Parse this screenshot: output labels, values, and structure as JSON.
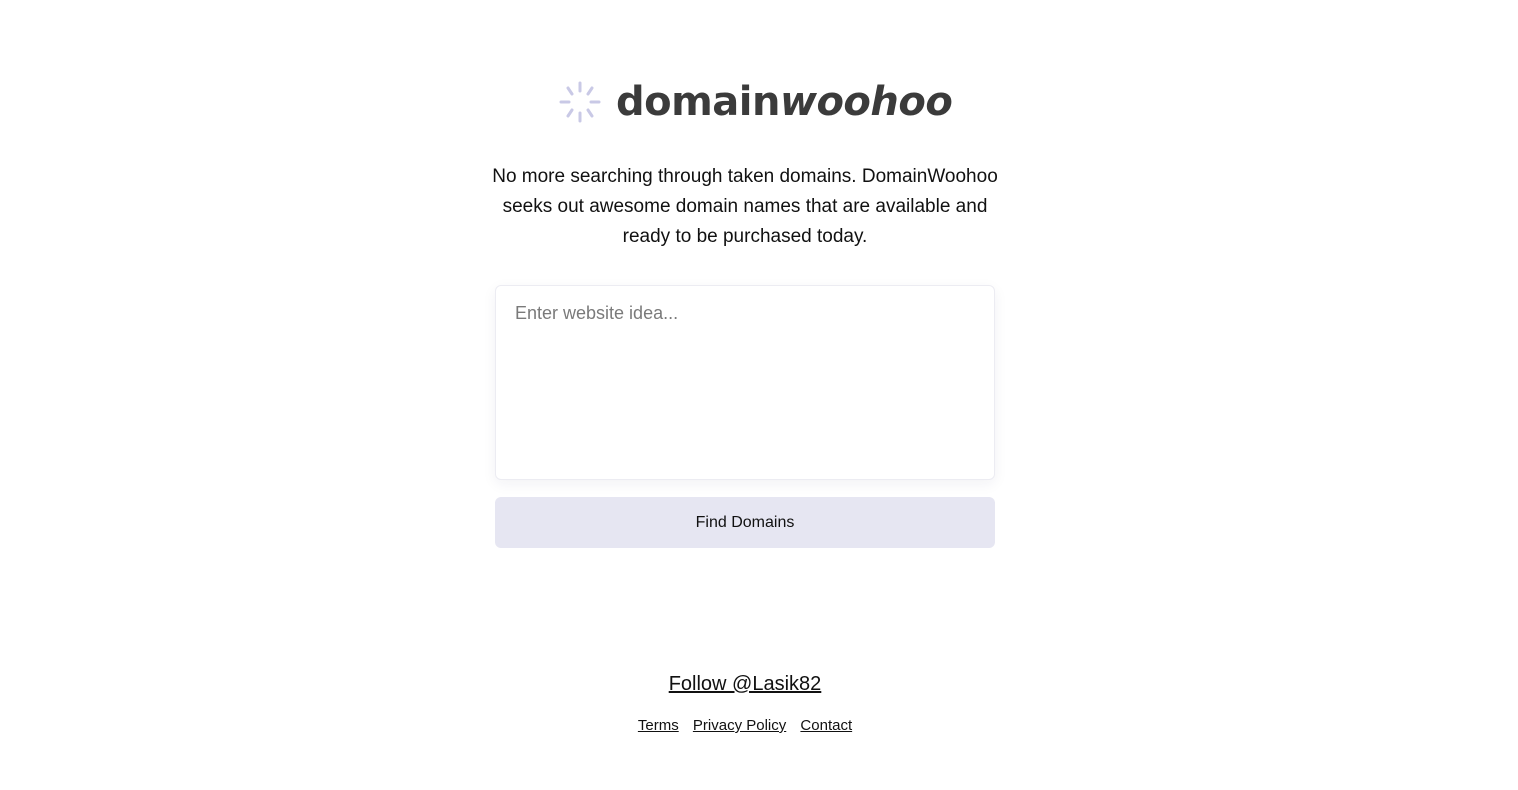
{
  "brand": {
    "name_regular": "domain",
    "name_italic": "woohoo",
    "icon": "spinner-icon",
    "icon_color": "#c9c9e6"
  },
  "tagline": "No more searching through taken domains. DomainWoohoo seeks out awesome domain names that are available and ready to be purchased today.",
  "search": {
    "placeholder": "Enter website idea...",
    "value": ""
  },
  "find_button": {
    "label": "Find Domains",
    "background": "#e6e6f2"
  },
  "follow": {
    "label": "Follow @Lasik82"
  },
  "footer": {
    "links": [
      {
        "label": "Terms"
      },
      {
        "label": "Privacy Policy"
      },
      {
        "label": "Contact"
      }
    ]
  }
}
